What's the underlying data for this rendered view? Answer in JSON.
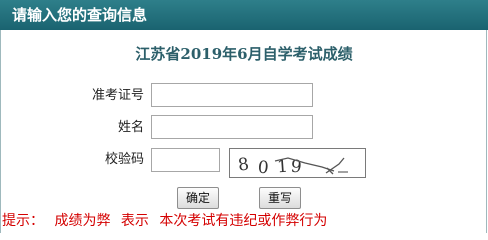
{
  "header": {
    "title": "请输入您的查询信息"
  },
  "exam": {
    "title": "江苏省2019年6月自学考试成绩"
  },
  "form": {
    "id_label": "准考证号",
    "id_value": "",
    "name_label": "姓名",
    "name_value": "",
    "captcha_label": "校验码",
    "captcha_value": "",
    "captcha_image_text": "8019"
  },
  "buttons": {
    "submit": "确定",
    "reset": "重写"
  },
  "notice": {
    "prefix": "提示：",
    "status": "成绩为弊",
    "meaning": "表示",
    "text": "本次考试有违纪或作弊行为"
  },
  "colors": {
    "header": "#1f6d78",
    "title": "#2c5f6a",
    "notice": "#d40000"
  }
}
